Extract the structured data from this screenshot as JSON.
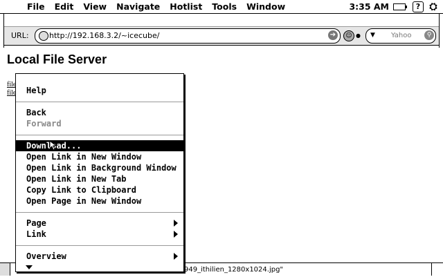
{
  "menubar": {
    "items": [
      "File",
      "Edit",
      "View",
      "Navigate",
      "Hotlist",
      "Tools",
      "Window"
    ],
    "clock": "3:35 AM"
  },
  "toolbar": {
    "url_label": "URL:",
    "url_value": "http://192.168.3.2/~icecube/",
    "search_placeholder": "Yahoo"
  },
  "page": {
    "title": "Local File Server",
    "links": [
      "file",
      "file"
    ]
  },
  "status": {
    "text": "949_ithilien_1280x1024.jpg\""
  },
  "context_menu": {
    "help": "Help",
    "back": "Back",
    "forward": "Forward",
    "download": "Download...",
    "open_new_window": "Open Link in New Window",
    "open_background": "Open Link in Background Window",
    "open_new_tab": "Open Link in New Tab",
    "copy_link": "Copy Link to Clipboard",
    "open_page_new_window": "Open Page in New Window",
    "page": "Page",
    "link": "Link",
    "overview": "Overview"
  }
}
